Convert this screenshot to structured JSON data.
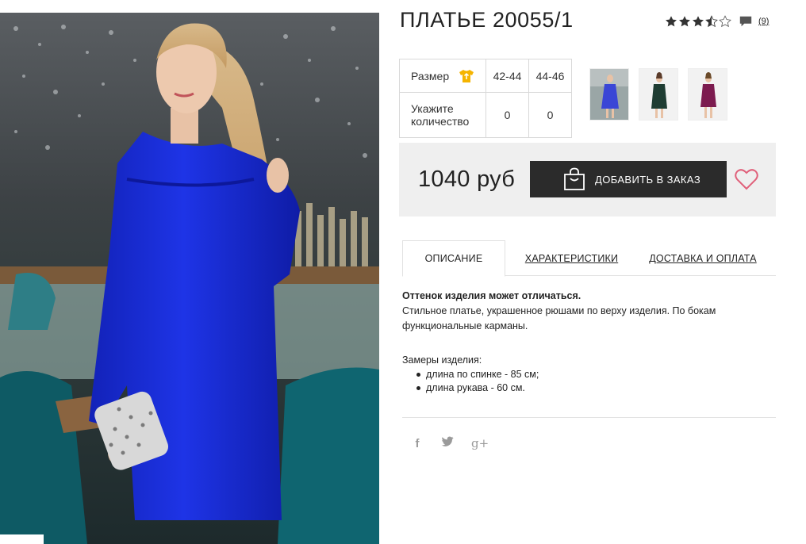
{
  "product": {
    "title": "ПЛАТЬЕ 20055/1",
    "rating": 3.5,
    "rating_max": 5,
    "review_count": "(9)"
  },
  "sizes": {
    "size_label": "Размер",
    "qty_label": "Укажите количество",
    "columns": [
      "42-44",
      "44-46"
    ],
    "quantities": [
      "0",
      "0"
    ]
  },
  "thumbnails": [
    {
      "color": "#3a46d6",
      "name": "blue"
    },
    {
      "color": "#1f3d33",
      "name": "green"
    },
    {
      "color": "#7c1b4f",
      "name": "burgundy"
    }
  ],
  "purchase": {
    "price": "1040 руб",
    "add_label": "ДОБАВИТЬ В ЗАКАЗ"
  },
  "tabs": [
    {
      "label": "ОПИСАНИЕ",
      "active": true
    },
    {
      "label": "ХАРАКТЕРИСТИКИ",
      "active": false
    },
    {
      "label": "ДОСТАВКА И ОПЛАТА",
      "active": false
    }
  ],
  "description": {
    "note": "Оттенок изделия может отличаться.",
    "text": "Стильное платье, украшенное рюшами по верху изделия. По бокам функциональные карманы.",
    "measures_title": "Замеры изделия:",
    "measures": [
      "длина по спинке - 85 см;",
      "длина рукава - 60 см."
    ]
  },
  "social": {
    "facebook": "f",
    "twitter": "🐦",
    "googleplus": "g+"
  },
  "colors": {
    "dress": "#1a2fd6",
    "accent_heart": "#e0607a",
    "button_bg": "#2b2b2b",
    "star": "#333333",
    "shirt_icon": "#f5b400"
  }
}
